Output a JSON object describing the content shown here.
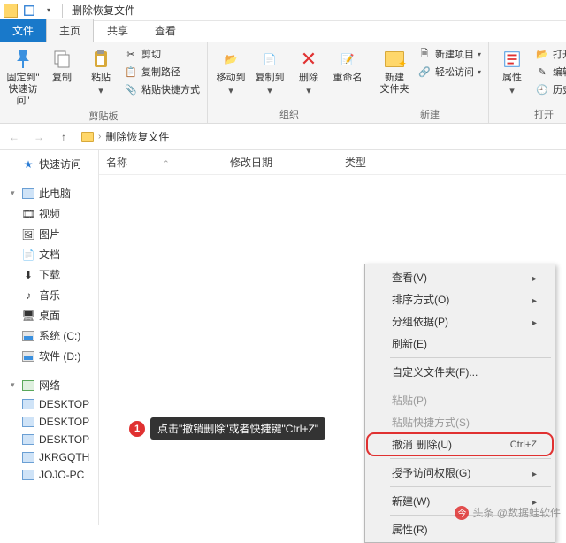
{
  "title": "删除恢复文件",
  "tabs": {
    "file": "文件",
    "home": "主页",
    "share": "共享",
    "view": "查看"
  },
  "ribbon": {
    "pin": "固定到\"\n快速访问\"",
    "copy": "复制",
    "paste": "粘贴",
    "cut": "剪切",
    "copypath": "复制路径",
    "pasteshortcut": "粘贴快捷方式",
    "clipboard_label": "剪贴板",
    "moveto": "移动到",
    "copyto": "复制到",
    "delete": "删除",
    "rename": "重命名",
    "organize_label": "组织",
    "newfolder": "新建\n文件夹",
    "newitem": "新建项目",
    "easyaccess": "轻松访问",
    "new_label": "新建",
    "properties": "属性",
    "open": "打开",
    "edit": "编辑",
    "history": "历史记录",
    "open_label": "打开"
  },
  "breadcrumb": {
    "current": "删除恢复文件"
  },
  "columns": {
    "name": "名称",
    "date": "修改日期",
    "type": "类型"
  },
  "sidebar": {
    "quick": "快速访问",
    "pc": "此电脑",
    "items": [
      "视频",
      "图片",
      "文档",
      "下载",
      "音乐",
      "桌面"
    ],
    "drives": [
      "系统 (C:)",
      "软件 (D:)"
    ],
    "network": "网络",
    "nets": [
      "DESKTOP",
      "DESKTOP",
      "DESKTOP",
      "JKRGQTH",
      "JOJO-PC"
    ]
  },
  "annotation": {
    "num": "1",
    "text": "点击\"撤销删除\"或者快捷键\"Ctrl+Z\""
  },
  "context_menu": {
    "view": "查看(V)",
    "sort": "排序方式(O)",
    "group": "分组依据(P)",
    "refresh": "刷新(E)",
    "customize": "自定义文件夹(F)...",
    "paste": "粘贴(P)",
    "pasteshortcut": "粘贴快捷方式(S)",
    "undo": "撤消 删除(U)",
    "undo_kb": "Ctrl+Z",
    "grantaccess": "授予访问权限(G)",
    "new": "新建(W)",
    "properties": "属性(R)"
  },
  "watermark": "头条 @数据蛙软件"
}
